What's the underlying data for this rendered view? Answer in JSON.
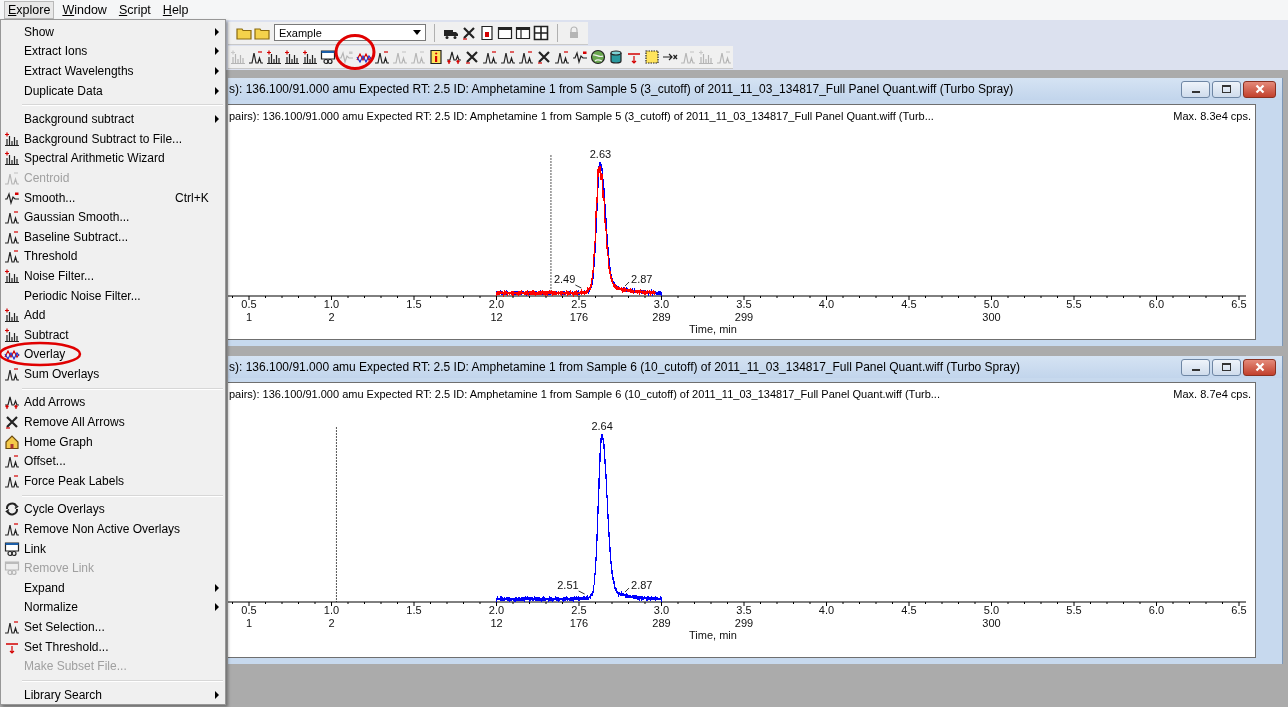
{
  "menu_bar": [
    {
      "label": "Explore",
      "selected": true
    },
    {
      "label": "Window",
      "selected": false
    },
    {
      "label": "Script",
      "selected": false
    },
    {
      "label": "Help",
      "selected": false
    }
  ],
  "toolbar": {
    "row_1": [
      {
        "kind": "button",
        "disabled": false
      },
      {
        "kind": "button",
        "disabled": false
      },
      {
        "kind": "dropdown",
        "value": "Example"
      },
      {
        "kind": "separator"
      },
      {
        "kind": "button",
        "disabled": false
      },
      {
        "kind": "button",
        "disabled": false
      },
      {
        "kind": "button",
        "disabled": false
      },
      {
        "kind": "button",
        "disabled": false
      },
      {
        "kind": "button",
        "disabled": false
      },
      {
        "kind": "button",
        "disabled": false
      },
      {
        "kind": "separator"
      },
      {
        "kind": "button",
        "disabled": true
      }
    ],
    "row_2": [
      {
        "kind": "button",
        "disabled": true
      },
      {
        "kind": "button",
        "disabled": false
      },
      {
        "kind": "button",
        "disabled": false
      },
      {
        "kind": "button",
        "disabled": false
      },
      {
        "kind": "button",
        "disabled": false
      },
      {
        "kind": "button",
        "disabled": false
      },
      {
        "kind": "button",
        "disabled": true
      },
      {
        "kind": "button",
        "disabled": false
      },
      {
        "kind": "button",
        "disabled": false
      },
      {
        "kind": "button",
        "disabled": true
      },
      {
        "kind": "button",
        "disabled": true
      },
      {
        "kind": "button",
        "disabled": false
      },
      {
        "kind": "button",
        "disabled": false
      },
      {
        "kind": "button",
        "disabled": false
      },
      {
        "kind": "button",
        "disabled": false
      },
      {
        "kind": "button",
        "disabled": false
      },
      {
        "kind": "button",
        "disabled": false
      },
      {
        "kind": "button",
        "disabled": false
      },
      {
        "kind": "button",
        "disabled": false
      },
      {
        "kind": "button",
        "disabled": false
      },
      {
        "kind": "button",
        "disabled": false
      },
      {
        "kind": "button",
        "disabled": false
      },
      {
        "kind": "button",
        "disabled": false
      },
      {
        "kind": "button",
        "disabled": false
      },
      {
        "kind": "button",
        "disabled": false
      },
      {
        "kind": "button",
        "disabled": true
      },
      {
        "kind": "button",
        "disabled": true
      },
      {
        "kind": "button",
        "disabled": true
      }
    ]
  },
  "menu": [
    {
      "kind": "item",
      "label": "Show",
      "submenu": true,
      "disabled": false
    },
    {
      "kind": "item",
      "label": "Extract Ions",
      "submenu": true,
      "disabled": false
    },
    {
      "kind": "item",
      "label": "Extract Wavelengths",
      "submenu": true,
      "disabled": false
    },
    {
      "kind": "item",
      "label": "Duplicate Data",
      "submenu": true,
      "disabled": false
    },
    {
      "kind": "separator"
    },
    {
      "kind": "item",
      "label": "Background subtract",
      "submenu": true,
      "disabled": false
    },
    {
      "kind": "item",
      "label": "Background Subtract to File...",
      "submenu": false,
      "disabled": false
    },
    {
      "kind": "item",
      "label": "Spectral Arithmetic Wizard",
      "submenu": false,
      "disabled": false
    },
    {
      "kind": "item",
      "label": "Centroid",
      "submenu": false,
      "disabled": true
    },
    {
      "kind": "item",
      "label": "Smooth...",
      "shortcut": "Ctrl+K",
      "submenu": false,
      "disabled": false
    },
    {
      "kind": "item",
      "label": "Gaussian Smooth...",
      "submenu": false,
      "disabled": false
    },
    {
      "kind": "item",
      "label": "Baseline Subtract...",
      "submenu": false,
      "disabled": false
    },
    {
      "kind": "item",
      "label": "Threshold",
      "submenu": false,
      "disabled": false
    },
    {
      "kind": "item",
      "label": "Noise Filter...",
      "submenu": false,
      "disabled": false
    },
    {
      "kind": "item",
      "label": "Periodic Noise Filter...",
      "submenu": false,
      "disabled": false
    },
    {
      "kind": "item",
      "label": "Add",
      "submenu": false,
      "disabled": false
    },
    {
      "kind": "item",
      "label": "Subtract",
      "submenu": false,
      "disabled": false
    },
    {
      "kind": "item",
      "label": "Overlay",
      "submenu": false,
      "disabled": false
    },
    {
      "kind": "item",
      "label": "Sum Overlays",
      "submenu": false,
      "disabled": false
    },
    {
      "kind": "separator"
    },
    {
      "kind": "item",
      "label": "Add Arrows",
      "submenu": false,
      "disabled": false
    },
    {
      "kind": "item",
      "label": "Remove All Arrows",
      "submenu": false,
      "disabled": false
    },
    {
      "kind": "item",
      "label": "Home Graph",
      "submenu": false,
      "disabled": false
    },
    {
      "kind": "item",
      "label": "Offset...",
      "submenu": false,
      "disabled": false
    },
    {
      "kind": "item",
      "label": "Force Peak Labels",
      "submenu": false,
      "disabled": false
    },
    {
      "kind": "separator"
    },
    {
      "kind": "item",
      "label": "Cycle Overlays",
      "submenu": false,
      "disabled": false
    },
    {
      "kind": "item",
      "label": "Remove Non Active Overlays",
      "submenu": false,
      "disabled": false
    },
    {
      "kind": "item",
      "label": "Link",
      "submenu": false,
      "disabled": false
    },
    {
      "kind": "item",
      "label": "Remove Link",
      "submenu": false,
      "disabled": true
    },
    {
      "kind": "item",
      "label": "Expand",
      "submenu": true,
      "disabled": false
    },
    {
      "kind": "item",
      "label": "Normalize",
      "submenu": true,
      "disabled": false
    },
    {
      "kind": "item",
      "label": "Set Selection...",
      "submenu": false,
      "disabled": false
    },
    {
      "kind": "item",
      "label": "Set Threshold...",
      "submenu": false,
      "disabled": false
    },
    {
      "kind": "item",
      "label": "Make Subset File...",
      "submenu": false,
      "disabled": true
    },
    {
      "kind": "separator"
    },
    {
      "kind": "item",
      "label": "Library Search",
      "submenu": true,
      "disabled": false
    }
  ],
  "windows": [
    {
      "title": "s): 136.100/91.000 amu Expected RT: 2.5 ID: Amphetamine 1 from Sample 5 (3_cutoff) of 2011_11_03_134817_Full Panel Quant.wiff (Turbo Spray)",
      "header": "pairs): 136.100/91.000 amu Expected RT: 2.5 ID: Amphetamine 1 from Sample 5 (3_cutoff) of 2011_11_03_134817_Full Panel Quant.wiff (Turb...",
      "max": "Max. 8.3e4 cps.",
      "traces": [
        {
          "color": "#ff0000"
        },
        {
          "color": "#0000ff"
        }
      ],
      "peaks": [
        {
          "kind": "apex",
          "label": "2.63"
        },
        {
          "kind": "start",
          "label": "2.49"
        },
        {
          "kind": "end",
          "label": "2.87"
        }
      ],
      "x_axis": {
        "title": "Time, min",
        "ticks": [
          {
            "label": "0.5",
            "scan": "1"
          },
          {
            "label": "1.0",
            "scan": "2"
          },
          {
            "label": "1.5"
          },
          {
            "label": "2.0",
            "scan": "12"
          },
          {
            "label": "2.5",
            "scan": "176"
          },
          {
            "label": "3.0",
            "scan": "289"
          },
          {
            "label": "3.5",
            "scan": "299"
          },
          {
            "label": "4.0"
          },
          {
            "label": "4.5"
          },
          {
            "label": "5.0",
            "scan": "300"
          },
          {
            "label": "5.5"
          },
          {
            "label": "6.0"
          },
          {
            "label": "6.5"
          }
        ]
      }
    },
    {
      "title": "s): 136.100/91.000 amu Expected RT: 2.5 ID: Amphetamine 1 from Sample 6 (10_cutoff) of 2011_11_03_134817_Full Panel Quant.wiff (Turbo Spray)",
      "header": "pairs): 136.100/91.000 amu Expected RT: 2.5 ID: Amphetamine 1 from Sample 6 (10_cutoff) of 2011_11_03_134817_Full Panel Quant.wiff (Turb...",
      "max": "Max. 8.7e4 cps.",
      "traces": [
        {
          "color": "#0000ff"
        }
      ],
      "peaks": [
        {
          "kind": "apex",
          "label": "2.64"
        },
        {
          "kind": "start",
          "label": "2.51"
        },
        {
          "kind": "end",
          "label": "2.87"
        }
      ],
      "x_axis": {
        "title": "Time, min",
        "ticks": [
          {
            "label": "0.5",
            "scan": "1"
          },
          {
            "label": "1.0",
            "scan": "2"
          },
          {
            "label": "1.5"
          },
          {
            "label": "2.0",
            "scan": "12"
          },
          {
            "label": "2.5",
            "scan": "176"
          },
          {
            "label": "3.0",
            "scan": "289"
          },
          {
            "label": "3.5",
            "scan": "299"
          },
          {
            "label": "4.0"
          },
          {
            "label": "4.5"
          },
          {
            "label": "5.0",
            "scan": "300"
          },
          {
            "label": "5.5"
          },
          {
            "label": "6.0"
          },
          {
            "label": "6.5"
          }
        ]
      }
    }
  ]
}
